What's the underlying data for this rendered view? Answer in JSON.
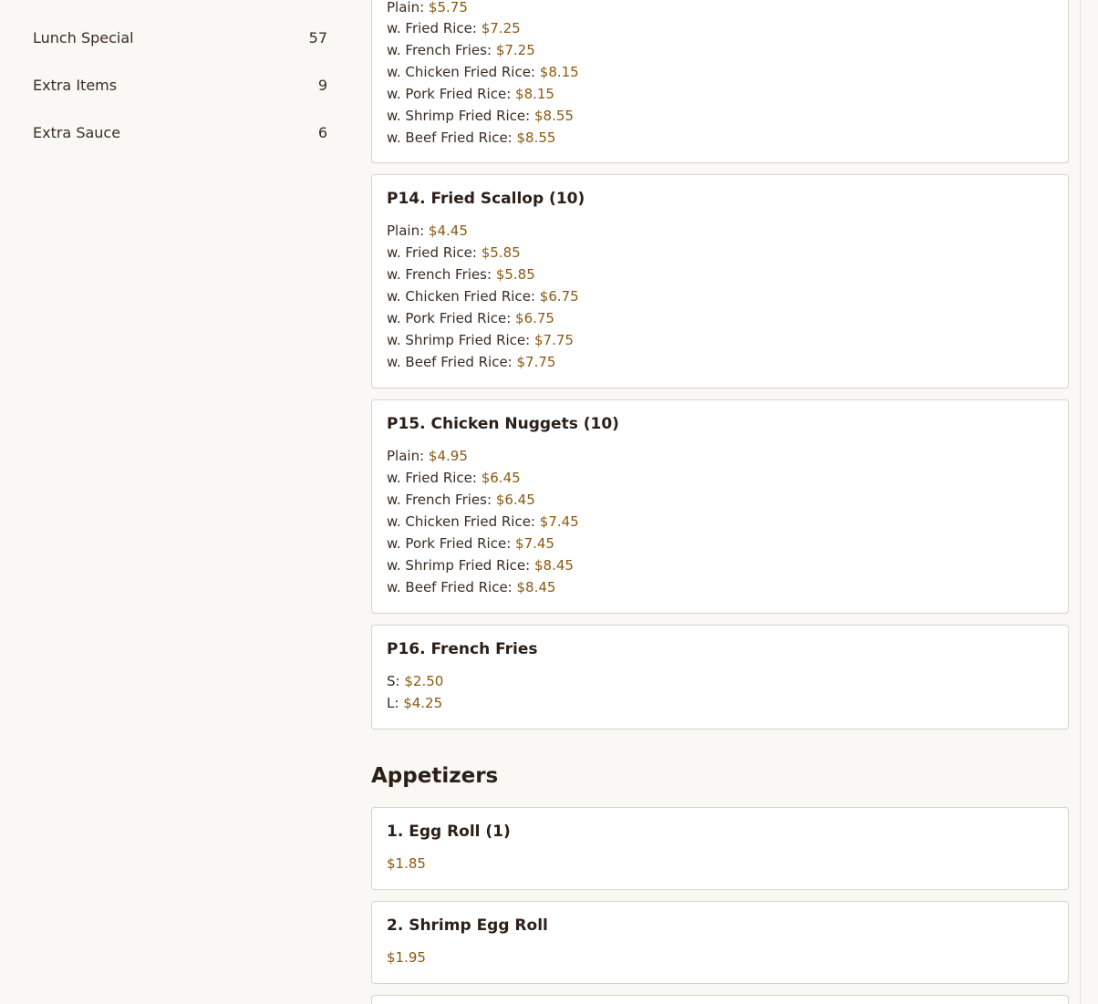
{
  "sidebar": {
    "categories": [
      {
        "label": "Lunch Special",
        "count": "57"
      },
      {
        "label": "Extra Items",
        "count": "9"
      },
      {
        "label": "Extra Sauce",
        "count": "6"
      }
    ]
  },
  "menu": {
    "p13_partial": {
      "lines": [
        {
          "label": "Plain:",
          "price": "$5.75"
        },
        {
          "label": "w. Fried Rice:",
          "price": "$7.25"
        },
        {
          "label": "w. French Fries:",
          "price": "$7.25"
        },
        {
          "label": "w. Chicken Fried Rice:",
          "price": "$8.15"
        },
        {
          "label": "w. Pork Fried Rice:",
          "price": "$8.15"
        },
        {
          "label": "w. Shrimp Fried Rice:",
          "price": "$8.55"
        },
        {
          "label": "w. Beef Fried Rice:",
          "price": "$8.55"
        }
      ]
    },
    "p14": {
      "title": "P14. Fried Scallop (10)",
      "lines": [
        {
          "label": "Plain:",
          "price": "$4.45"
        },
        {
          "label": "w. Fried Rice:",
          "price": "$5.85"
        },
        {
          "label": "w. French Fries:",
          "price": "$5.85"
        },
        {
          "label": "w. Chicken Fried Rice:",
          "price": "$6.75"
        },
        {
          "label": "w. Pork Fried Rice:",
          "price": "$6.75"
        },
        {
          "label": "w. Shrimp Fried Rice:",
          "price": "$7.75"
        },
        {
          "label": "w. Beef Fried Rice:",
          "price": "$7.75"
        }
      ]
    },
    "p15": {
      "title": "P15. Chicken Nuggets (10)",
      "lines": [
        {
          "label": "Plain:",
          "price": "$4.95"
        },
        {
          "label": "w. Fried Rice:",
          "price": "$6.45"
        },
        {
          "label": "w. French Fries:",
          "price": "$6.45"
        },
        {
          "label": "w. Chicken Fried Rice:",
          "price": "$7.45"
        },
        {
          "label": "w. Pork Fried Rice:",
          "price": "$7.45"
        },
        {
          "label": "w. Shrimp Fried Rice:",
          "price": "$8.45"
        },
        {
          "label": "w. Beef Fried Rice:",
          "price": "$8.45"
        }
      ]
    },
    "p16": {
      "title": "P16. French Fries",
      "lines": [
        {
          "label": "S:",
          "price": "$2.50"
        },
        {
          "label": "L:",
          "price": "$4.25"
        }
      ]
    },
    "appetizers": {
      "section_title": "Appetizers",
      "items": [
        {
          "title": "1. Egg Roll (1)",
          "price": "$1.85"
        },
        {
          "title": "2. Shrimp Egg Roll",
          "price": "$1.95"
        }
      ]
    }
  }
}
